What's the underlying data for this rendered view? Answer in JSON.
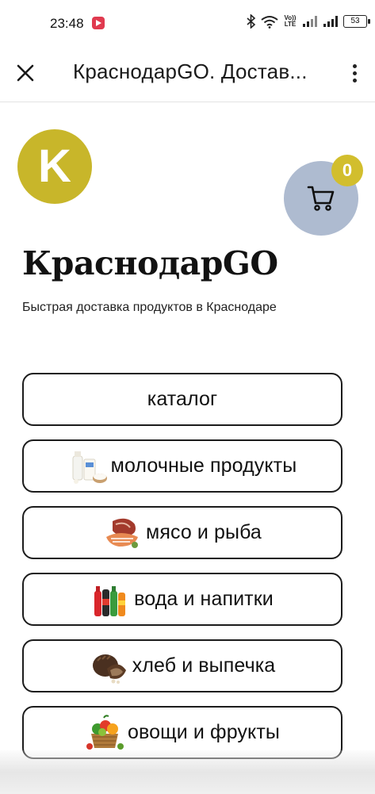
{
  "status_bar": {
    "time": "23:48",
    "volte_label": "Vo)) LTE",
    "battery": "53"
  },
  "app_bar": {
    "title": "КраснодарGO. Достав..."
  },
  "logo": {
    "letter": "K"
  },
  "cart": {
    "count": "0"
  },
  "header": {
    "title": "КраснодарGO",
    "subtitle": "Быстрая доставка продуктов в Краснодаре"
  },
  "categories": [
    {
      "label": "каталог",
      "icon": ""
    },
    {
      "label": "молочные продукты",
      "icon": "dairy-icon"
    },
    {
      "label": "мясо и рыба",
      "icon": "meat-fish-icon"
    },
    {
      "label": "вода и напитки",
      "icon": "drinks-icon"
    },
    {
      "label": "хлеб и выпечка",
      "icon": "bread-icon"
    },
    {
      "label": "овощи и фрукты",
      "icon": "vegetables-icon"
    }
  ],
  "colors": {
    "logo_bg": "#c8b62a",
    "cart_bg": "#aebbd0",
    "badge_bg": "#d2be2d"
  }
}
